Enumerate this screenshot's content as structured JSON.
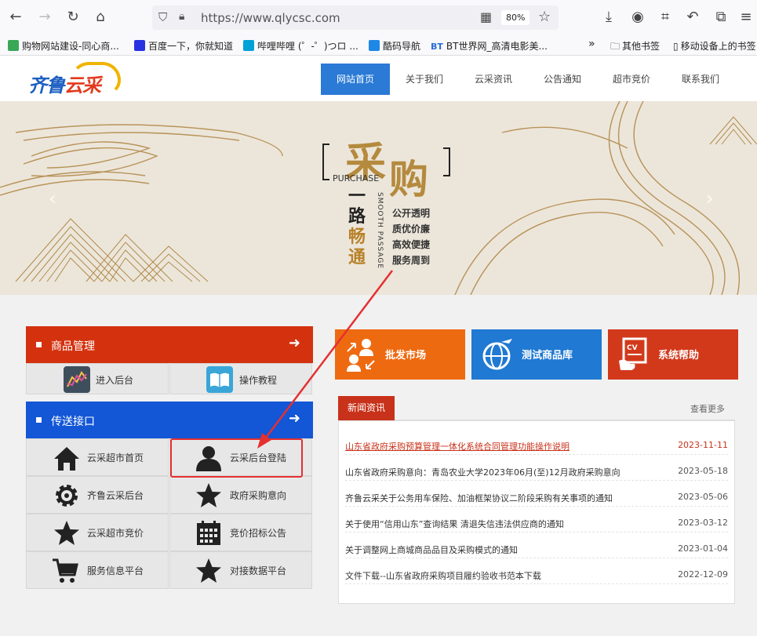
{
  "browser": {
    "url": "https://www.qlycsc.com",
    "zoom": "80%",
    "bookmarks": [
      "购物网站建设-同心商...",
      "百度一下，你就知道",
      "哔哩哔哩 (゜-゜)つロ ...",
      "酷码导航",
      "BT世界网_高清电影美...",
      "其他书签",
      "移动设备上的书签"
    ]
  },
  "header": {
    "logo_text_blue": "齐鲁",
    "logo_text_red": "云采",
    "nav": [
      "网站首页",
      "关于我们",
      "云采资讯",
      "公告通知",
      "超市竞价",
      "联系我们"
    ]
  },
  "banner": {
    "big1": "采",
    "big2": "购",
    "purchase": "PURCHASE",
    "vertical": [
      "一",
      "路",
      "畅",
      "通"
    ],
    "smooth": "SMOOTH PASSAGE",
    "slogans": [
      "公开透明",
      "质优价廉",
      "高效便捷",
      "服务周到"
    ]
  },
  "panel1": {
    "title": "商品管理",
    "items": [
      "进入后台",
      "操作教程"
    ]
  },
  "panel2": {
    "title": "传送接口",
    "items": [
      "云采超市首页",
      "云采后台登陆",
      "齐鲁云采后台",
      "政府采购意向",
      "云采超市竞价",
      "竞价招标公告",
      "服务信息平台",
      "对接数据平台"
    ]
  },
  "tiles": [
    {
      "label": "批发市场",
      "color": "#ee6a10"
    },
    {
      "label": "测试商品库",
      "color": "#2079d2"
    },
    {
      "label": "系统帮助",
      "color": "#d2391b"
    }
  ],
  "news": {
    "tab": "新闻资讯",
    "more": "查看更多",
    "items": [
      {
        "title": "山东省政府采购预算管理一体化系统合同管理功能操作说明",
        "date": "2023-11-11"
      },
      {
        "title": "山东省政府采购意向：青岛农业大学2023年06月(至)12月政府采购意向",
        "date": "2023-05-18"
      },
      {
        "title": "齐鲁云采关于公务用车保险、加油框架协议二阶段采购有关事项的通知",
        "date": "2023-05-06"
      },
      {
        "title": "关于使用“信用山东”查询结果 清退失信违法供应商的通知",
        "date": "2023-03-12"
      },
      {
        "title": "关于调整网上商城商品品目及采购模式的通知",
        "date": "2023-01-04"
      },
      {
        "title": "文件下载--山东省政府采购项目履约验收书范本下载",
        "date": "2022-12-09"
      }
    ]
  },
  "colors": {
    "panel1": "#d4320f",
    "panel2": "#1356d6",
    "nav_active": "#2a7ad6",
    "news_accent": "#c8321a"
  }
}
